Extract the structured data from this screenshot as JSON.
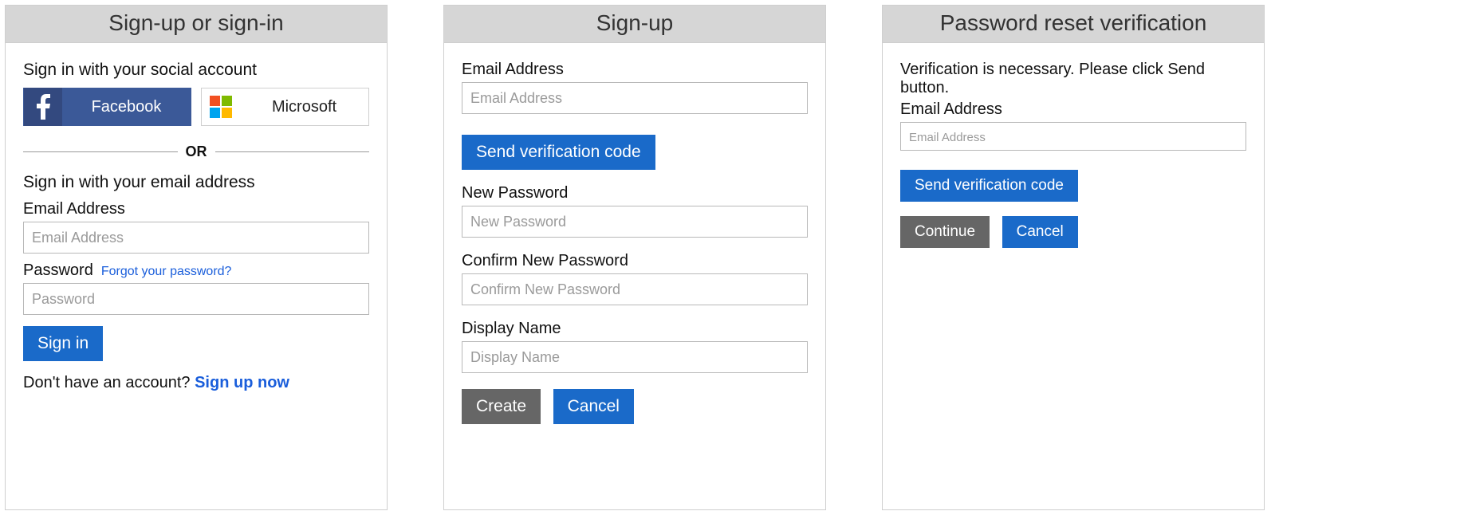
{
  "signin": {
    "title": "Sign-up or sign-in",
    "social_heading": "Sign in with your social account",
    "facebook_label": "Facebook",
    "microsoft_label": "Microsoft",
    "or_text": "OR",
    "email_heading": "Sign in with your email address",
    "email_label": "Email Address",
    "email_placeholder": "Email Address",
    "password_label": "Password",
    "forgot_link": "Forgot your password?",
    "password_placeholder": "Password",
    "signin_button": "Sign in",
    "no_account_text": "Don't have an account?",
    "signup_link": "Sign up now"
  },
  "signup": {
    "title": "Sign-up",
    "email_label": "Email Address",
    "email_placeholder": "Email Address",
    "send_code_button": "Send verification code",
    "new_password_label": "New Password",
    "new_password_placeholder": "New Password",
    "confirm_password_label": "Confirm New Password",
    "confirm_password_placeholder": "Confirm New Password",
    "display_name_label": "Display Name",
    "display_name_placeholder": "Display Name",
    "create_button": "Create",
    "cancel_button": "Cancel"
  },
  "reset": {
    "title": "Password reset verification",
    "intro_text": "Verification is necessary. Please click Send button.",
    "email_label": "Email Address",
    "email_placeholder": "Email Address",
    "send_code_button": "Send verification code",
    "continue_button": "Continue",
    "cancel_button": "Cancel"
  }
}
